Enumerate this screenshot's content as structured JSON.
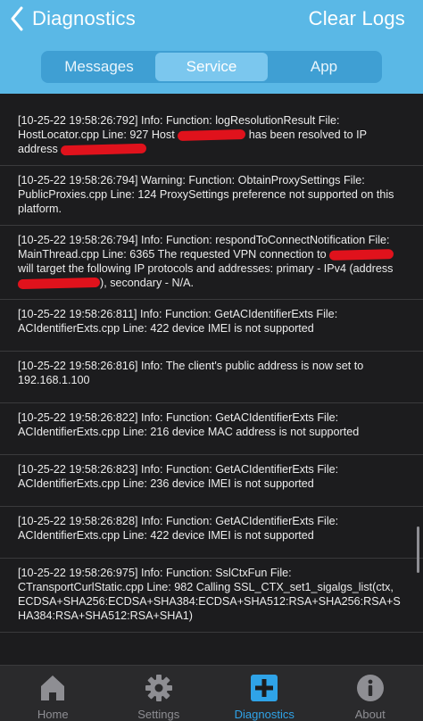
{
  "header": {
    "back_label": "Diagnostics",
    "action_label": "Clear Logs",
    "segments": [
      "Messages",
      "Service",
      "App"
    ],
    "selected_segment": "Service"
  },
  "logs": [
    {
      "parts": [
        "[10-25-22 19:58:26:792] Info: Function: logResolutionResult File: HostLocator.cpp Line: 927 Host",
        "has been resolved to IP address",
        ""
      ]
    },
    {
      "parts": [
        "[10-25-22 19:58:26:794] Warning: Function: ObtainProxySettings File: PublicProxies.cpp Line: 124 ProxySettings preference not supported on this platform."
      ]
    },
    {
      "parts": [
        "[10-25-22 19:58:26:794] Info: Function: respondToConnectNotification File: MainThread.cpp Line: 6365 The requested VPN connection to",
        "will target the following IP protocols and addresses: primary - IPv4 (address",
        "), secondary - N/A."
      ]
    },
    {
      "parts": [
        "[10-25-22 19:58:26:811] Info: Function: GetACIdentifierExts File: ACIdentifierExts.cpp Line: 422 device IMEI is not supported"
      ]
    },
    {
      "parts": [
        "[10-25-22 19:58:26:816] Info: The client's public address is now set to 192.168.1.100"
      ]
    },
    {
      "parts": [
        "[10-25-22 19:58:26:822] Info: Function: GetACIdentifierExts File: ACIdentifierExts.cpp Line: 216 device MAC address is not supported"
      ]
    },
    {
      "parts": [
        "[10-25-22 19:58:26:823] Info: Function: GetACIdentifierExts File: ACIdentifierExts.cpp Line: 236 device IMEI is not supported"
      ]
    },
    {
      "parts": [
        "[10-25-22 19:58:26:828] Info: Function: GetACIdentifierExts File: ACIdentifierExts.cpp Line: 422 device IMEI is not supported"
      ]
    },
    {
      "parts": [
        "[10-25-22 19:58:26:975] Info: Function: SslCtxFun File: CTransportCurlStatic.cpp Line: 982 Calling SSL_CTX_set1_sigalgs_list(ctx, ECDSA+SHA256:ECDSA+SHA384:ECDSA+SHA512:RSA+SHA256:RSA+SHA384:RSA+SHA512:RSA+SHA1)"
      ]
    }
  ],
  "tabs": [
    {
      "label": "Home",
      "icon": "home-icon"
    },
    {
      "label": "Settings",
      "icon": "gear-icon"
    },
    {
      "label": "Diagnostics",
      "icon": "diagnostics-plus-icon"
    },
    {
      "label": "About",
      "icon": "info-icon"
    }
  ],
  "active_tab": "Diagnostics",
  "colors": {
    "header": "#5ab8e6",
    "segment_bg": "#3f9fd3",
    "segment_active": "#7bc7ee",
    "background": "#1c1c1e",
    "redaction": "#e0121c",
    "tab_active": "#2fa3e8",
    "tab_inactive": "#8e8e93"
  }
}
